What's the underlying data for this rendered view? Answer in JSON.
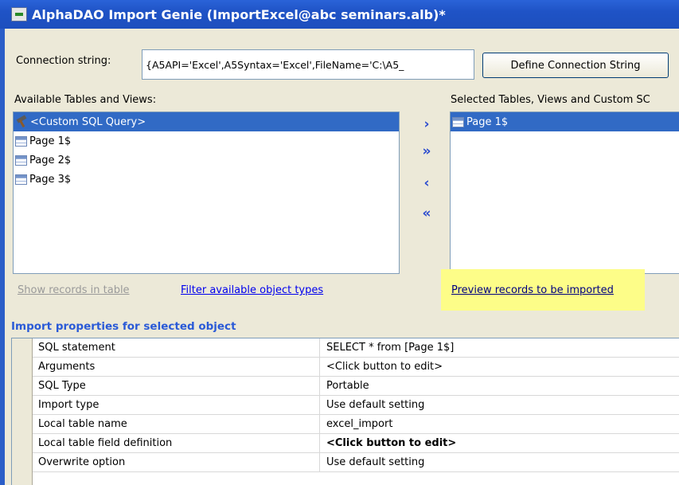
{
  "window": {
    "title": "AlphaDAO Import Genie (ImportExcel@abc seminars.alb)*"
  },
  "connection": {
    "label": "Connection string:",
    "value": "{A5API='Excel',A5Syntax='Excel',FileName='C:\\A5_",
    "button_label": "Define Connection String"
  },
  "available": {
    "label": "Available Tables and Views:",
    "items": [
      {
        "label": "<Custom SQL Query>",
        "icon": "tools-icon",
        "selected": true
      },
      {
        "label": "Page 1$",
        "icon": "table-icon"
      },
      {
        "label": "Page 2$",
        "icon": "table-icon"
      },
      {
        "label": "Page 3$",
        "icon": "table-icon"
      }
    ]
  },
  "transfer": {
    "add_one": "›",
    "add_all": "»",
    "remove_one": "‹",
    "remove_all": "«"
  },
  "selected": {
    "label": "Selected Tables, Views and Custom SC",
    "items": [
      {
        "label": "Page 1$",
        "icon": "table-icon",
        "selected": true
      }
    ]
  },
  "links": {
    "show_records": "Show records in table",
    "filter_types": "Filter available object types",
    "preview_records": "Preview records to be imported"
  },
  "properties": {
    "title": "Import properties for selected object",
    "rows": [
      {
        "name": "SQL statement",
        "value": "SELECT * from [Page 1$]"
      },
      {
        "name": "Arguments",
        "value": "<Click button to edit>"
      },
      {
        "name": "SQL Type",
        "value": "Portable"
      },
      {
        "name": "Import type",
        "value": "Use default setting"
      },
      {
        "name": "Local table name",
        "value": "excel_import"
      },
      {
        "name": "Local table field definition",
        "value": "<Click button to edit>"
      },
      {
        "name": "Overwrite option",
        "value": "Use default setting"
      }
    ]
  },
  "colors": {
    "title_bar": "#1f53c6",
    "selection": "#316ac5",
    "highlight": "#fdfd88",
    "link": "#0000ee",
    "section_title": "#2a5ad7"
  }
}
